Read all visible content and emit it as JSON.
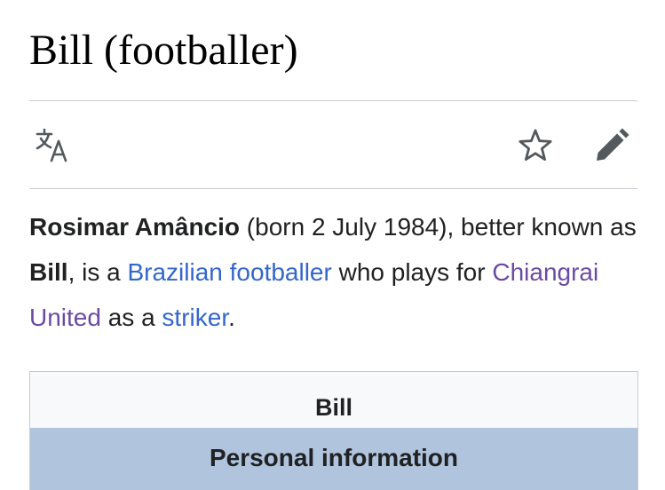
{
  "page": {
    "title": "Bill (footballer)"
  },
  "toolbar": {
    "language_icon": "translate-icon",
    "watch_icon": "star-outline-icon",
    "edit_icon": "pencil-icon",
    "icon_color": "#54595d"
  },
  "lead": {
    "bold_name": "Rosimar Amâncio",
    "text_1": " (born 2 July 1984), better known as ",
    "bold_nickname": "Bill",
    "text_2": ", is a ",
    "link_brazilian_footballer": "Brazilian footballer",
    "text_3": " who plays for ",
    "link_club": "Chiangrai United",
    "text_4": " as a ",
    "link_position": "striker",
    "text_5": "."
  },
  "infobox": {
    "title": "Bill",
    "section_header": "Personal information",
    "header_color": "#b0c4de"
  },
  "colors": {
    "link": "#3366cc",
    "visited_link": "#6b4ba1",
    "text": "#202122",
    "divider": "#c8ccd1"
  }
}
